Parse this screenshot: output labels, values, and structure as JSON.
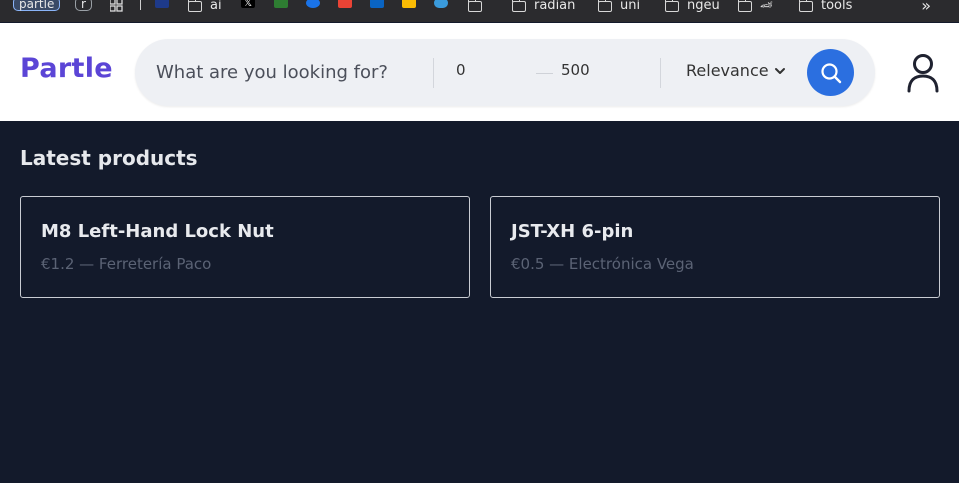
{
  "bookmarks": {
    "items": [
      {
        "label": "partle",
        "type": "pill"
      },
      {
        "label": "r",
        "type": "pill"
      },
      {
        "label": "ai",
        "type": "folder"
      },
      {
        "label": "radian",
        "type": "folder"
      },
      {
        "label": "uni",
        "type": "folder"
      },
      {
        "label": "ngeu",
        "type": "folder"
      },
      {
        "label": "tools",
        "type": "folder"
      }
    ],
    "more_label": "»"
  },
  "header": {
    "logo": "Partle",
    "search": {
      "placeholder": "What are you looking for?",
      "value": ""
    },
    "price_min": "0",
    "price_max": "500",
    "sort_label": "Relevance"
  },
  "main": {
    "section_title": "Latest products",
    "products": [
      {
        "name": "M8 Left-Hand Lock Nut",
        "meta": "€1.2 — Ferretería Paco"
      },
      {
        "name": "JST-XH 6-pin",
        "meta": "€0.5 — Electrónica Vega"
      }
    ]
  },
  "colors": {
    "brand": "#5b45d6",
    "search_button": "#2b6fe0",
    "background": "#131a2b"
  }
}
